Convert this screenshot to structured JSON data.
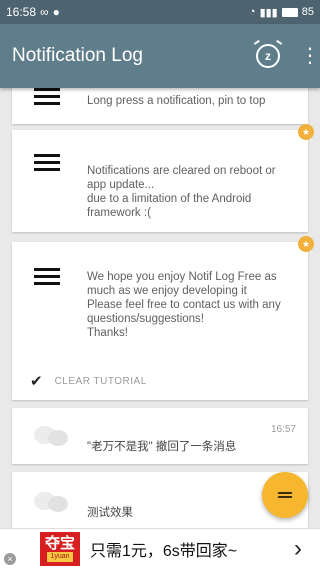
{
  "status_bar": {
    "time": "16:58",
    "left_icons": [
      "infinity-icon",
      "chat-bubble-icon"
    ],
    "wifi_icon": "wifi-icon",
    "signal_icon": "signal-icon",
    "battery_level": "85"
  },
  "app_bar": {
    "title": "Notification Log",
    "snooze_icon_text": "z",
    "more_icon": "more-vert-icon"
  },
  "tutorial_cards": [
    {
      "title": "",
      "body": "Long press a notification, pin to top"
    },
    {
      "title": "",
      "body": "Notifications are cleared on reboot or\napp update...\ndue to a limitation of the Android\nframework :("
    },
    {
      "title": "",
      "body": "We hope you enjoy Notif Log Free as\nmuch as we enjoy developing it\nPlease feel free to contact us with any\nquestions/suggestions!\nThanks!"
    }
  ],
  "clear_tutorial": {
    "label": "CLEAR TUTORIAL"
  },
  "notifications": [
    {
      "title": "",
      "body": "\"老万不是我\" 撤回了一条消息",
      "time": "16:57"
    },
    {
      "title": "",
      "body": "测试效果",
      "time": ""
    }
  ],
  "fab": {
    "icon": "filter-icon"
  },
  "ad": {
    "logo_main": "夺宝",
    "logo_sub": "1yuan",
    "text": "只需1元，6s带回家~",
    "arrow": "›",
    "close": "×"
  },
  "colors": {
    "status_bar": "#4d6370",
    "app_bar": "#607d8b",
    "accent": "#f6b62e",
    "ad_red": "#d71f1f"
  }
}
